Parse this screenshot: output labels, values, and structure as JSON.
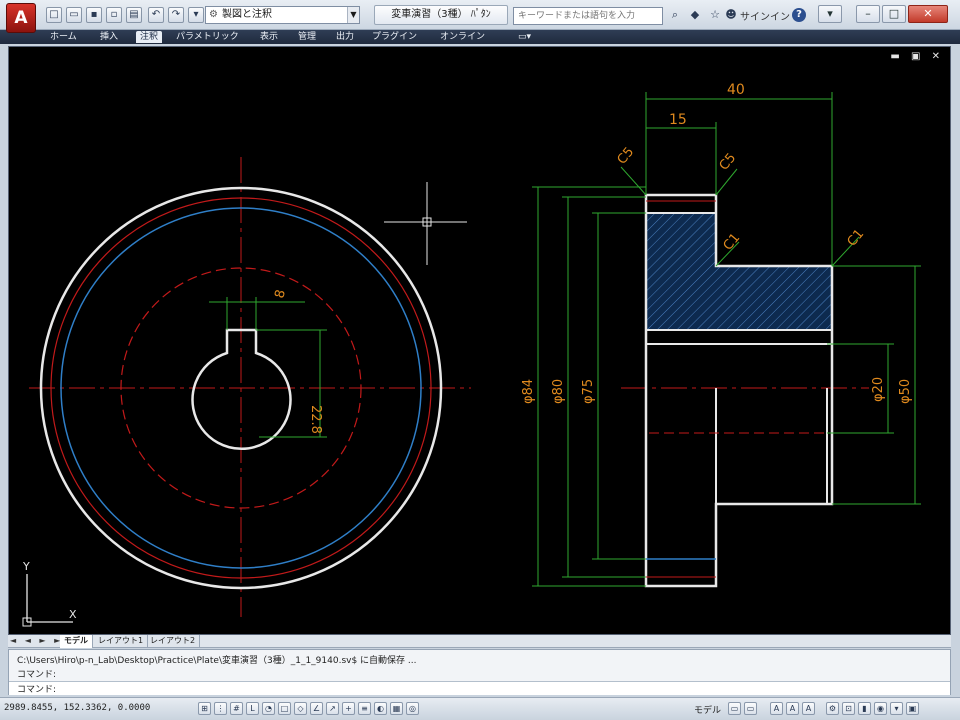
{
  "titlebar": {
    "app_logo": "A",
    "workspace": "製図と注釈",
    "document_title": "変車演習（3種）",
    "document_suffix": "ﾊﾟﾀﾝ",
    "search_placeholder": "キーワードまたは語句を入力",
    "signin_label": "サインイン",
    "help": "?"
  },
  "ribbon": {
    "tabs": [
      "ホーム",
      "挿入",
      "注釈",
      "パラメトリック",
      "表示",
      "管理",
      "出力",
      "プラグイン",
      "オンライン"
    ],
    "active_index": 2
  },
  "drawing": {
    "dimensions": {
      "overall_width": "40",
      "hub_width": "15",
      "key_width": "8",
      "key_depth": "22.8",
      "chamfer_left": "C5",
      "chamfer_right": "C5",
      "chamfer_inner": "C1",
      "chamfer_outer": "C1",
      "dia_outer": "φ84",
      "dia_second": "φ80",
      "dia_pitch": "φ75",
      "dia_bore": "φ20",
      "dia_hub": "φ50"
    },
    "ucs_x": "X",
    "ucs_y": "Y"
  },
  "layout_tabs": {
    "nav": "◄ ◄ ► ►",
    "tabs": [
      "モデル",
      "レイアウト1",
      "レイアウト2"
    ],
    "active_index": 0
  },
  "command_window": {
    "history": "C:\\Users\\Hiro\\p-n_Lab\\Desktop\\Practice\\Plate\\変車演習（3種）_1_1_9140.sv$ に自動保存 ...",
    "prompt1": "コマンド:",
    "input_value": "コマンド:"
  },
  "status_bar": {
    "coordinates": "2989.8455, 152.3362, 0.0000",
    "model_label": "モデル"
  }
}
